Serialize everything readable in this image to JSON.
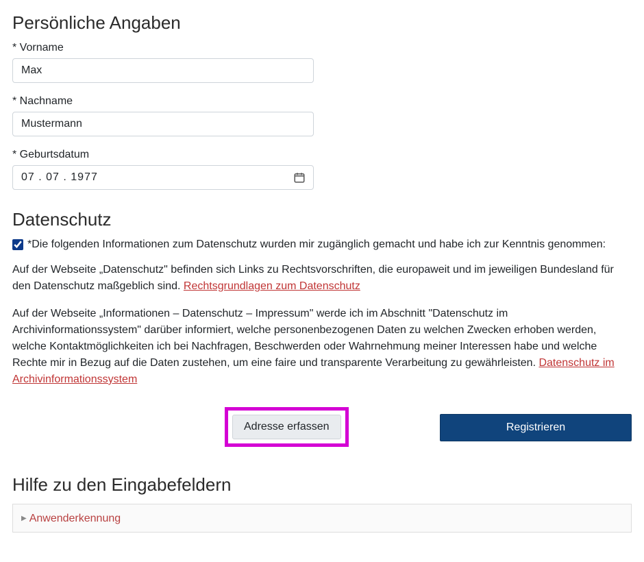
{
  "personal": {
    "heading": "Persönliche Angaben",
    "vorname_label": "* Vorname",
    "vorname_value": "Max",
    "nachname_label": "* Nachname",
    "nachname_value": "Mustermann",
    "gebdat_label": "* Geburtsdatum",
    "gebdat_value": "07 . 07 . 1977"
  },
  "privacy": {
    "heading": "Datenschutz",
    "checkbox_label": "*Die folgenden Informationen zum Datenschutz wurden mir zugänglich gemacht und habe ich zur Kenntnis genommen:",
    "para1_pre": "Auf der Webseite „Datenschutz\" befinden sich Links zu Rechtsvorschriften, die europaweit und im jeweiligen Bundesland für den Datenschutz maßgeblich sind. ",
    "link1": "Rechtsgrundlagen zum Datenschutz",
    "para2_pre": "Auf der Webseite „Informationen – Datenschutz – Impressum\" werde ich im Abschnitt \"Datenschutz im Archivinformationssystem\" darüber informiert, welche personenbezogenen Daten zu welchen Zwecken erhoben werden, welche Kontaktmöglichkeiten ich bei Nachfragen, Beschwerden oder Wahrnehmung meiner Interessen habe und welche Rechte mir in Bezug auf die Daten zustehen, um eine faire und transparente Verarbeitung zu gewährleisten. ",
    "link2": "Datenschutz im Archivinformationssystem"
  },
  "buttons": {
    "adresse": "Adresse erfassen",
    "registrieren": "Registrieren"
  },
  "help": {
    "heading": "Hilfe zu den Eingabefeldern",
    "item1": "Anwenderkennung"
  }
}
